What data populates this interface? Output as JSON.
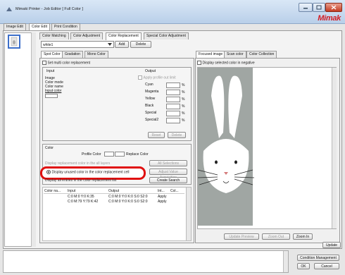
{
  "window": {
    "title": "Mimaki Printer - Job Editor [ Full Color ]",
    "logo": "Mimak"
  },
  "main_tabs": [
    "Image Edit",
    "Color Edit",
    "Print Condition"
  ],
  "sub_tabs": [
    "Color Matching",
    "Color Adjustment",
    "Color Replacement",
    "Special Color Adjustment"
  ],
  "replacement": {
    "profile_name": "white1",
    "add_label": "Add",
    "delete_label": "Delete"
  },
  "left_tabs": [
    "Spot Color",
    "Gradation",
    "Mono Color"
  ],
  "set_multi": "Set multi color replacement",
  "input": {
    "heading": "Input",
    "image": "Image",
    "color_mode": "Color mode",
    "color_name": "Color name",
    "input_color": "Input color"
  },
  "output": {
    "heading": "Output",
    "apply_profile": "Apply profile out limit",
    "channels": [
      "Cyan",
      "Magenta",
      "Yellow",
      "Black",
      "Special",
      "Special2"
    ],
    "pct": "%",
    "reset": "Reset",
    "delete": "Delete"
  },
  "color_section": {
    "heading": "Color",
    "profile_color": "Profile Color",
    "replace_color": "Replace Color",
    "all_subst_line": "Display replacement color in the all layers",
    "all_selections": "All Selections",
    "highlight_option": "Display unused color in the color replacement cell",
    "adjust_color": "Adjust Value Acquisition",
    "display_all": "Display all entries in the color replacement list",
    "create_search": "Create Search"
  },
  "table": {
    "headers": [
      "Color na...",
      "Input",
      "Output",
      "Int...",
      "Col..."
    ],
    "rows": [
      {
        "name": "",
        "input": "C:0 M:0 Y:0 K:35",
        "output": "C:0 M:0 Y:0 K:0 S:0 S2:0",
        "apply": "Apply"
      },
      {
        "name": "",
        "input": "C:0 M:79 Y:79 K:42",
        "output": "C:0 M:0 Y:0 K:0 S:0 S2:0",
        "apply": "Apply"
      }
    ]
  },
  "right_tabs": [
    "Focused image",
    "Scan color",
    "Color Collection"
  ],
  "display_selected": "Display selected color in negative",
  "preview_buttons": {
    "update_preview": "Update Preview",
    "zoom_out": "Zoom Out",
    "zoom_in": "Zoom In",
    "update": "Update"
  },
  "bottom": {
    "condition_mgmt": "Condition Management",
    "ok": "OK",
    "cancel": "Cancel"
  },
  "colors": {
    "highlight": "#e01010",
    "logo_red": "#d21b22"
  }
}
